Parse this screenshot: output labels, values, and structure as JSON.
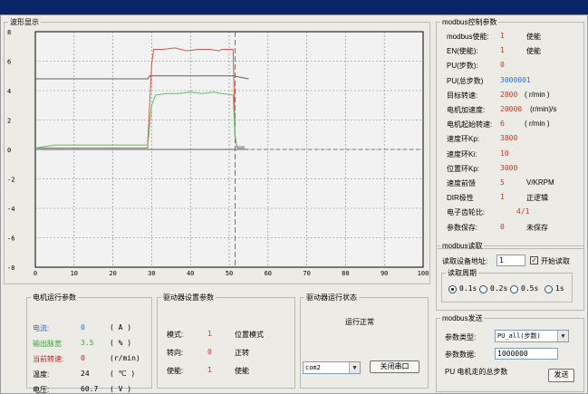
{
  "waveform": {
    "title": "波形显示"
  },
  "chart_data": {
    "type": "line",
    "xlim": [
      0,
      100
    ],
    "ylim": [
      -8,
      8
    ],
    "xticks": [
      "0",
      "10",
      "20",
      "30",
      "40",
      "50",
      "60",
      "70",
      "80",
      "90",
      "100"
    ],
    "yticks": [
      "8",
      "6",
      "4",
      "2",
      "0",
      "-2",
      "-4",
      "-6",
      "-8"
    ],
    "grid": true,
    "cursor_x": 51.5,
    "series": [
      {
        "color": "#e05050",
        "x": [
          0,
          29,
          29,
          30,
          30.5,
          33,
          36,
          39,
          42,
          45,
          47.5,
          48,
          51,
          51.5,
          52,
          54
        ],
        "y": [
          0.1,
          0.1,
          0.5,
          5.8,
          6.8,
          6.8,
          6.9,
          6.7,
          6.8,
          6.8,
          6.7,
          6.8,
          6.8,
          1.0,
          0.1,
          0.1
        ]
      },
      {
        "color": "#60c060",
        "x": [
          0,
          5,
          29,
          30,
          31,
          34,
          37,
          40,
          43,
          46,
          48,
          51,
          51.5,
          52,
          54
        ],
        "y": [
          0.1,
          0.3,
          0.3,
          3.0,
          3.7,
          3.8,
          3.8,
          3.9,
          3.8,
          3.9,
          3.8,
          3.7,
          0.8,
          0.2,
          0.2
        ]
      },
      {
        "color": "#606060",
        "x": [
          0,
          29,
          29.5,
          51,
          55
        ],
        "y": [
          4.8,
          4.8,
          5.0,
          5.0,
          4.8
        ]
      },
      {
        "color": "#606060",
        "x": [
          0,
          55
        ],
        "y": [
          0,
          0
        ]
      }
    ]
  },
  "motor_params": {
    "title": "电机运行参数",
    "rows": [
      {
        "label": "电流:",
        "value": "0",
        "unit": "( A )",
        "color": "#2f6fd8"
      },
      {
        "label": "输出脉宽",
        "value": "3.5",
        "unit": "( % )",
        "color": "#3ea03e"
      },
      {
        "label": "当前转速:",
        "value": "0",
        "unit": "(r/min)",
        "color": "#d02020"
      },
      {
        "label": "温度:",
        "value": "24",
        "unit": "( ℃ )",
        "color": "#000000"
      },
      {
        "label": "电压:",
        "value": "60.7",
        "unit": "( V )",
        "color": "#000000"
      }
    ]
  },
  "driver_settings": {
    "title": "驱动器设置参数",
    "rows": [
      {
        "label": "模式:",
        "value": "1",
        "desc": "位置模式"
      },
      {
        "label": "转向:",
        "value": "0",
        "desc": "正转"
      },
      {
        "label": "使能:",
        "value": "1",
        "desc": "使能"
      }
    ]
  },
  "driver_status": {
    "title": "驱动器运行状态",
    "status": "运行正常",
    "port": "com2",
    "close_btn": "关闭串口"
  },
  "modbus_control": {
    "title": "modbus控制参数",
    "rows": [
      {
        "label": "modbus使能:",
        "value": "1",
        "desc": "使能",
        "color": "#c0392b"
      },
      {
        "label": "EN(使能):",
        "value": "1",
        "desc": "使能",
        "color": "#c0392b"
      },
      {
        "label": "PU(步数):",
        "value": "0",
        "desc": "",
        "color": "#c0392b"
      },
      {
        "label": "PU(总步数)",
        "value": "3000001",
        "desc": "",
        "color": "#2f6fd8"
      },
      {
        "label": "目标转速:",
        "value": "2800",
        "desc": "( r/min )",
        "color": "#c0392b"
      },
      {
        "label": "电机加速度:",
        "value": "20000",
        "desc": "(r/min)/s",
        "color": "#c0392b"
      },
      {
        "label": "电机起始转速:",
        "value": "6",
        "desc": "( r/min )",
        "color": "#c0392b"
      },
      {
        "label": "速度环Kp:",
        "value": "3800",
        "desc": "",
        "color": "#c0392b"
      },
      {
        "label": "速度环Ki:",
        "value": "10",
        "desc": "",
        "color": "#c0392b"
      },
      {
        "label": "位置环Kp:",
        "value": "3000",
        "desc": "",
        "color": "#c0392b"
      },
      {
        "label": "速度前馈",
        "value": "5",
        "desc": "V/KRPM",
        "color": "#c0392b"
      },
      {
        "label": "DIR极性",
        "value": "1",
        "desc": "正逻辑",
        "color": "#c0392b"
      },
      {
        "label": "电子齿轮比:",
        "value": "4/1",
        "desc": "",
        "color": "#c0392b"
      },
      {
        "label": "参数保存:",
        "value": "0",
        "desc": "未保存",
        "color": "#c0392b"
      }
    ]
  },
  "modbus_read": {
    "title": "modbus读取",
    "addr_label": "读取设备地址:",
    "addr_value": "1",
    "start_label": "开始读取",
    "start_checked": "✓",
    "period_title": "读取周期",
    "periods": [
      "0.1s",
      "0.2s",
      "0.5s",
      "1s"
    ]
  },
  "modbus_send": {
    "title": "modbus发送",
    "type_label": "参数类型:",
    "type_value": "PU_all(步数)",
    "data_label": "参数数据:",
    "data_value": "1000000",
    "hint": "PU 电机走的总步数",
    "send_btn": "发送"
  }
}
